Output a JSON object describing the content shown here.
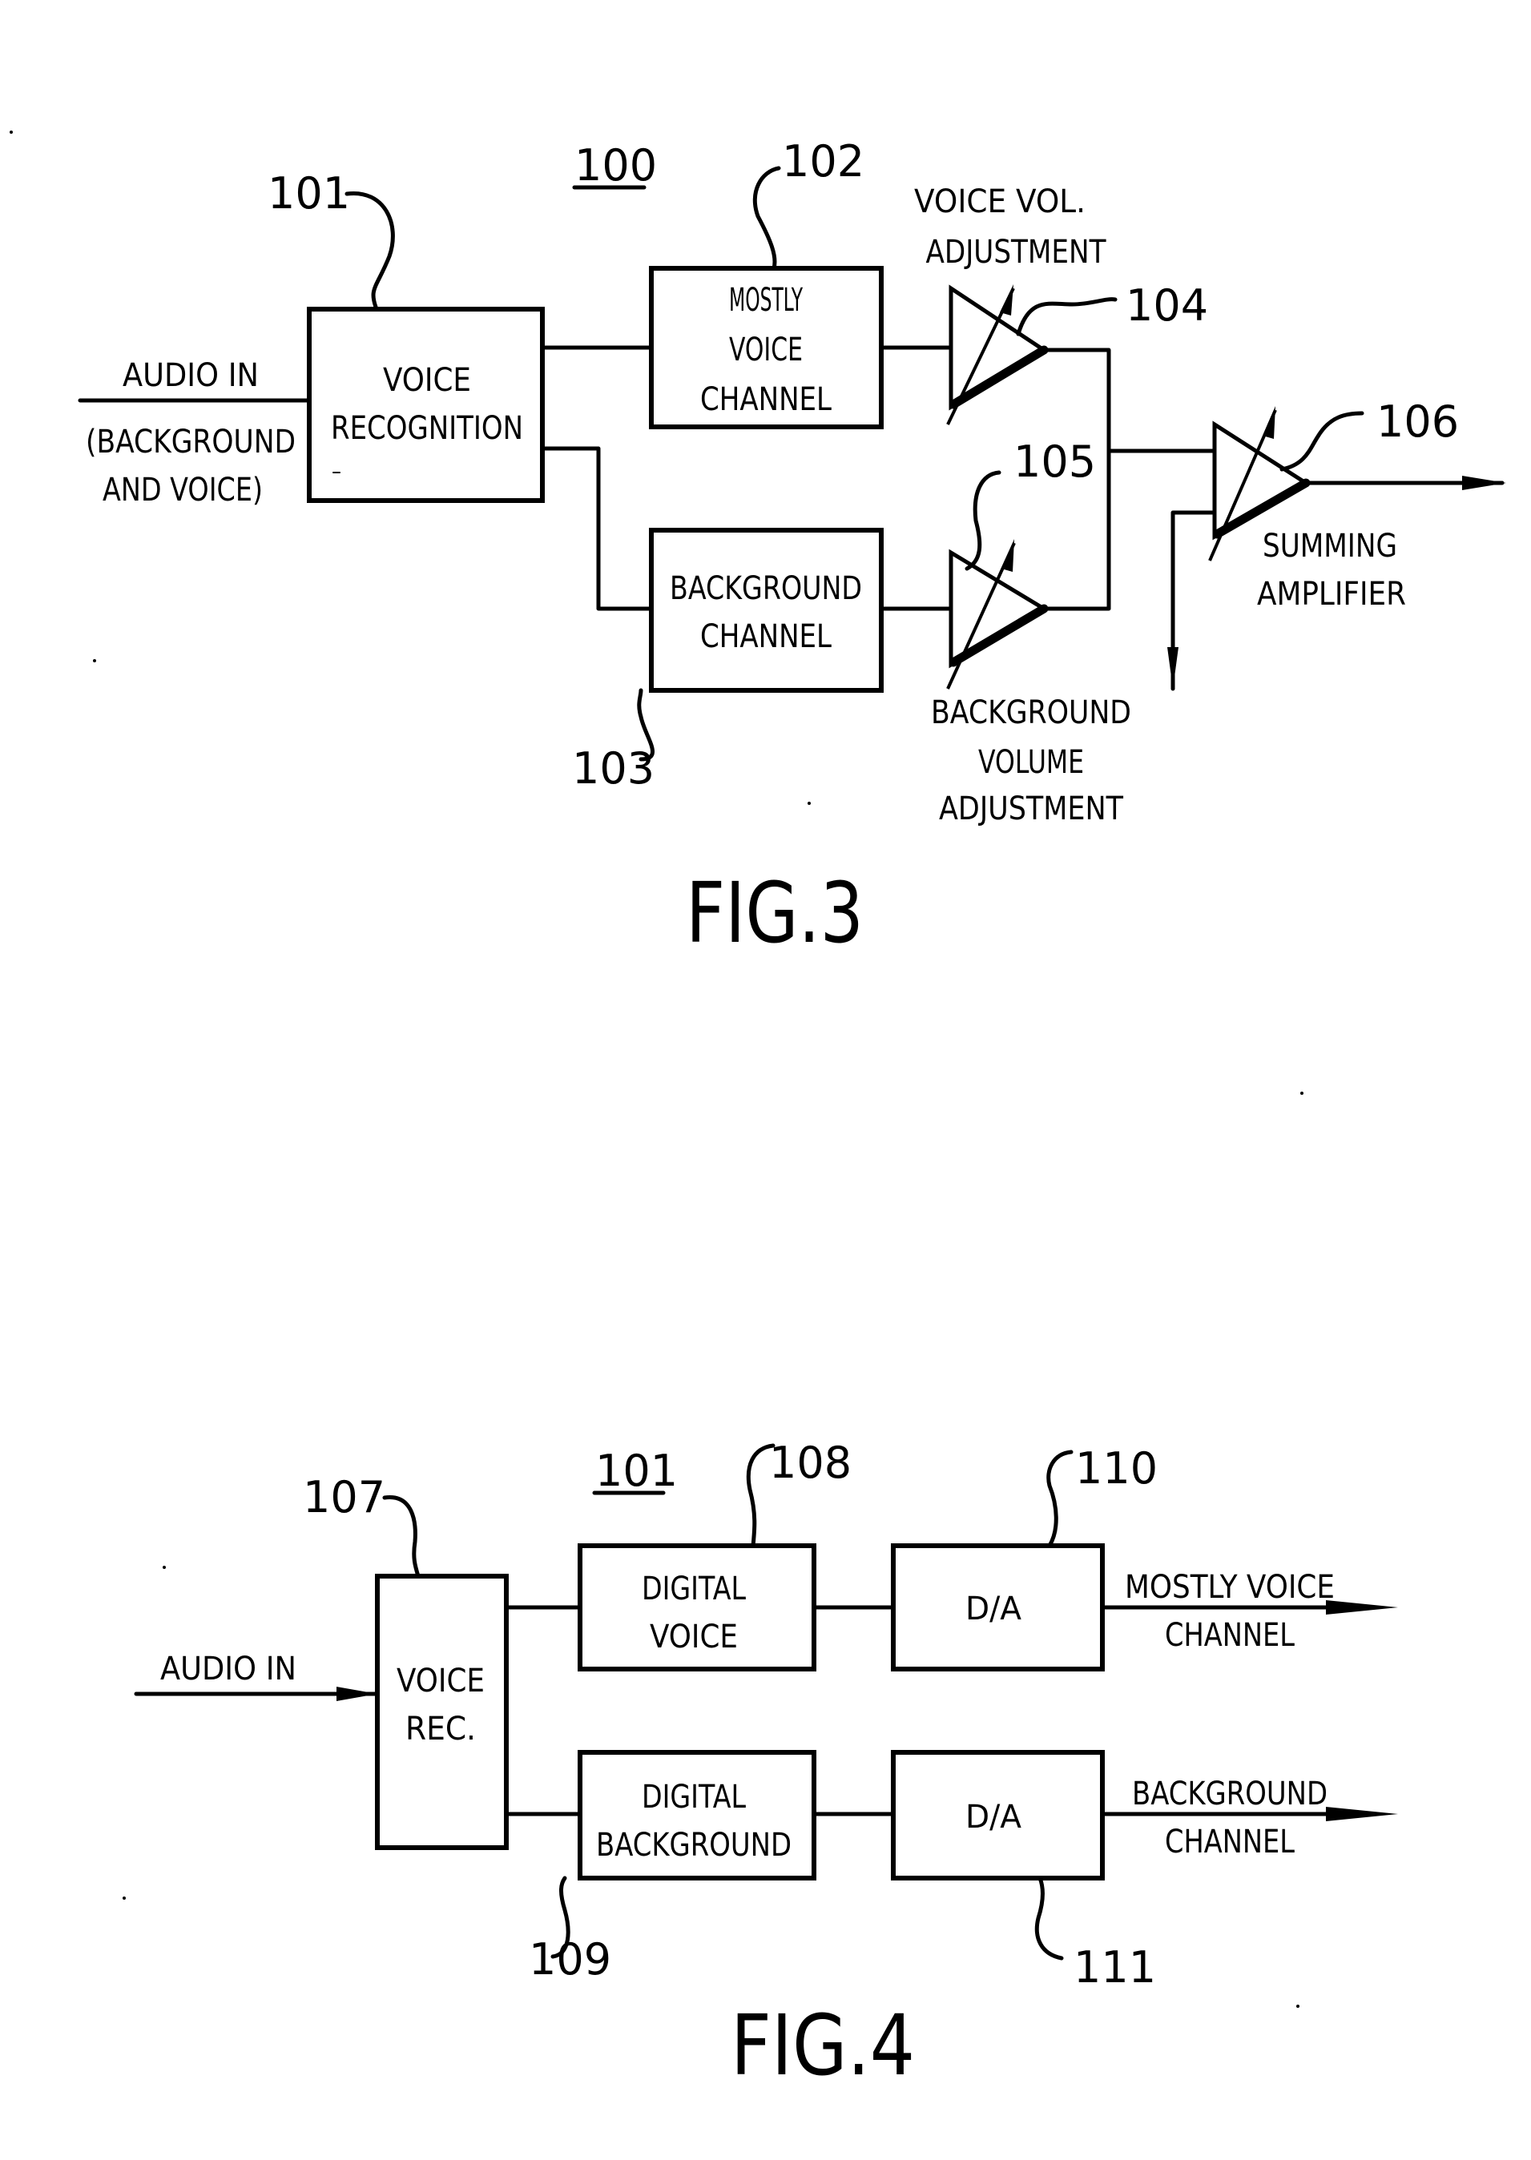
{
  "fig3": {
    "caption": "FIG.3",
    "system_ref": "100",
    "input_label": [
      "AUDIO IN",
      "(BACKGROUND",
      "AND VOICE)"
    ],
    "voice_recognition": {
      "ref": "101",
      "lines": [
        "VOICE",
        "RECOGNITION"
      ]
    },
    "mostly_voice_channel": {
      "ref": "102",
      "lines": [
        "MOSTLY",
        "VOICE",
        "CHANNEL"
      ]
    },
    "background_channel": {
      "ref": "103",
      "lines": [
        "BACKGROUND",
        "CHANNEL"
      ]
    },
    "voice_vol_amp": {
      "ref": "104",
      "label": [
        "VOICE VOL.",
        "ADJUSTMENT"
      ]
    },
    "background_vol_amp": {
      "ref": "105",
      "label": [
        "BACKGROUND",
        "VOLUME",
        "ADJUSTMENT"
      ]
    },
    "summing_amp": {
      "ref": "106",
      "label": [
        "SUMMING",
        "AMPLIFIER"
      ]
    }
  },
  "fig4": {
    "caption": "FIG.4",
    "system_ref": "101",
    "input_label": "AUDIO IN",
    "voice_rec": {
      "ref": "107",
      "lines": [
        "VOICE",
        "REC."
      ]
    },
    "digital_voice": {
      "ref": "108",
      "lines": [
        "DIGITAL",
        "VOICE"
      ]
    },
    "digital_background": {
      "ref": "109",
      "lines": [
        "DIGITAL",
        "BACKGROUND"
      ]
    },
    "da_top": {
      "ref": "110",
      "label": "D/A"
    },
    "da_bottom": {
      "ref": "111",
      "label": "D/A"
    },
    "output_top": [
      "MOSTLY VOICE",
      "CHANNEL"
    ],
    "output_bottom": [
      "BACKGROUND",
      "CHANNEL"
    ]
  }
}
